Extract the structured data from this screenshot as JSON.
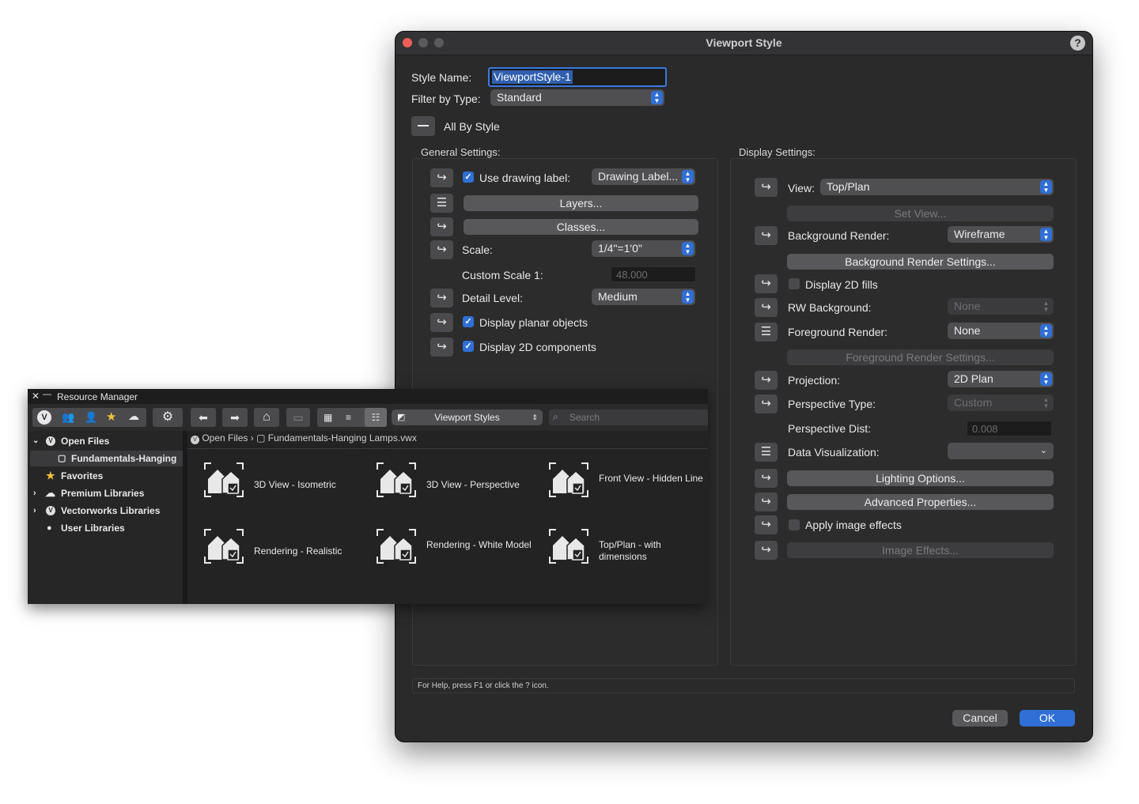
{
  "dialog": {
    "title": "Viewport Style",
    "help_label": "?",
    "style_name_label": "Style Name:",
    "style_name_value": "ViewportStyle-1",
    "filter_label": "Filter by Type:",
    "filter_value": "Standard",
    "all_by_style_label": "All By Style",
    "general": {
      "title": "General Settings:",
      "use_drawing_label": "Use drawing label:",
      "drawing_label_value": "Drawing Label...",
      "layers_button": "Layers...",
      "classes_button": "Classes...",
      "scale_label": "Scale:",
      "scale_value": "1/4\"=1'0\"",
      "custom_scale_label": "Custom Scale 1:",
      "custom_scale_value": "48.000",
      "detail_level_label": "Detail Level:",
      "detail_level_value": "Medium",
      "display_planar_label": "Display planar objects",
      "display_2d_components_label": "Display 2D components"
    },
    "display": {
      "title": "Display Settings:",
      "view_label": "View:",
      "view_value": "Top/Plan",
      "set_view_button": "Set View...",
      "background_render_label": "Background Render:",
      "background_render_value": "Wireframe",
      "background_render_settings_button": "Background Render Settings...",
      "display_2d_fills_label": "Display 2D fills",
      "rw_background_label": "RW Background:",
      "rw_background_value": "None",
      "foreground_render_label": "Foreground Render:",
      "foreground_render_value": "None",
      "foreground_render_settings_button": "Foreground Render Settings...",
      "projection_label": "Projection:",
      "projection_value": "2D Plan",
      "perspective_type_label": "Perspective Type:",
      "perspective_type_value": "Custom",
      "perspective_dist_label": "Perspective Dist:",
      "perspective_dist_value": "0.008",
      "data_visualization_label": "Data Visualization:",
      "data_visualization_value": "",
      "lighting_options_button": "Lighting Options...",
      "advanced_properties_button": "Advanced Properties...",
      "apply_image_effects_label": "Apply image effects",
      "image_effects_button": "Image Effects..."
    },
    "help_text": "For Help, press F1 or click the ? icon.",
    "cancel_label": "Cancel",
    "ok_label": "OK"
  },
  "resource_manager": {
    "title": "Resource Manager",
    "close_glyph": "✕",
    "minimize_glyph": "—",
    "type_value": "Viewport Styles",
    "search_placeholder": "Search",
    "tree": [
      {
        "label": "Open Files"
      },
      {
        "label": "Fundamentals-Hanging"
      },
      {
        "label": "Favorites"
      },
      {
        "label": "Premium Libraries"
      },
      {
        "label": "Vectorworks Libraries"
      },
      {
        "label": "User Libraries"
      }
    ],
    "breadcrumb": {
      "root": "Open Files",
      "separator": "›",
      "file": "Fundamentals-Hanging Lamps.vwx"
    },
    "resources": [
      {
        "label": "3D View - Isometric"
      },
      {
        "label": "3D View - Perspective"
      },
      {
        "label": "Front View - Hidden Line"
      },
      {
        "label": "Rendering - Realistic"
      },
      {
        "label": "Rendering - White Model"
      },
      {
        "label": "Top/Plan - with dimensions"
      }
    ]
  },
  "colors": {
    "accent": "#2f6fd6",
    "dialog_bg": "#2a2a2b",
    "close_light": "#ec5f57"
  }
}
